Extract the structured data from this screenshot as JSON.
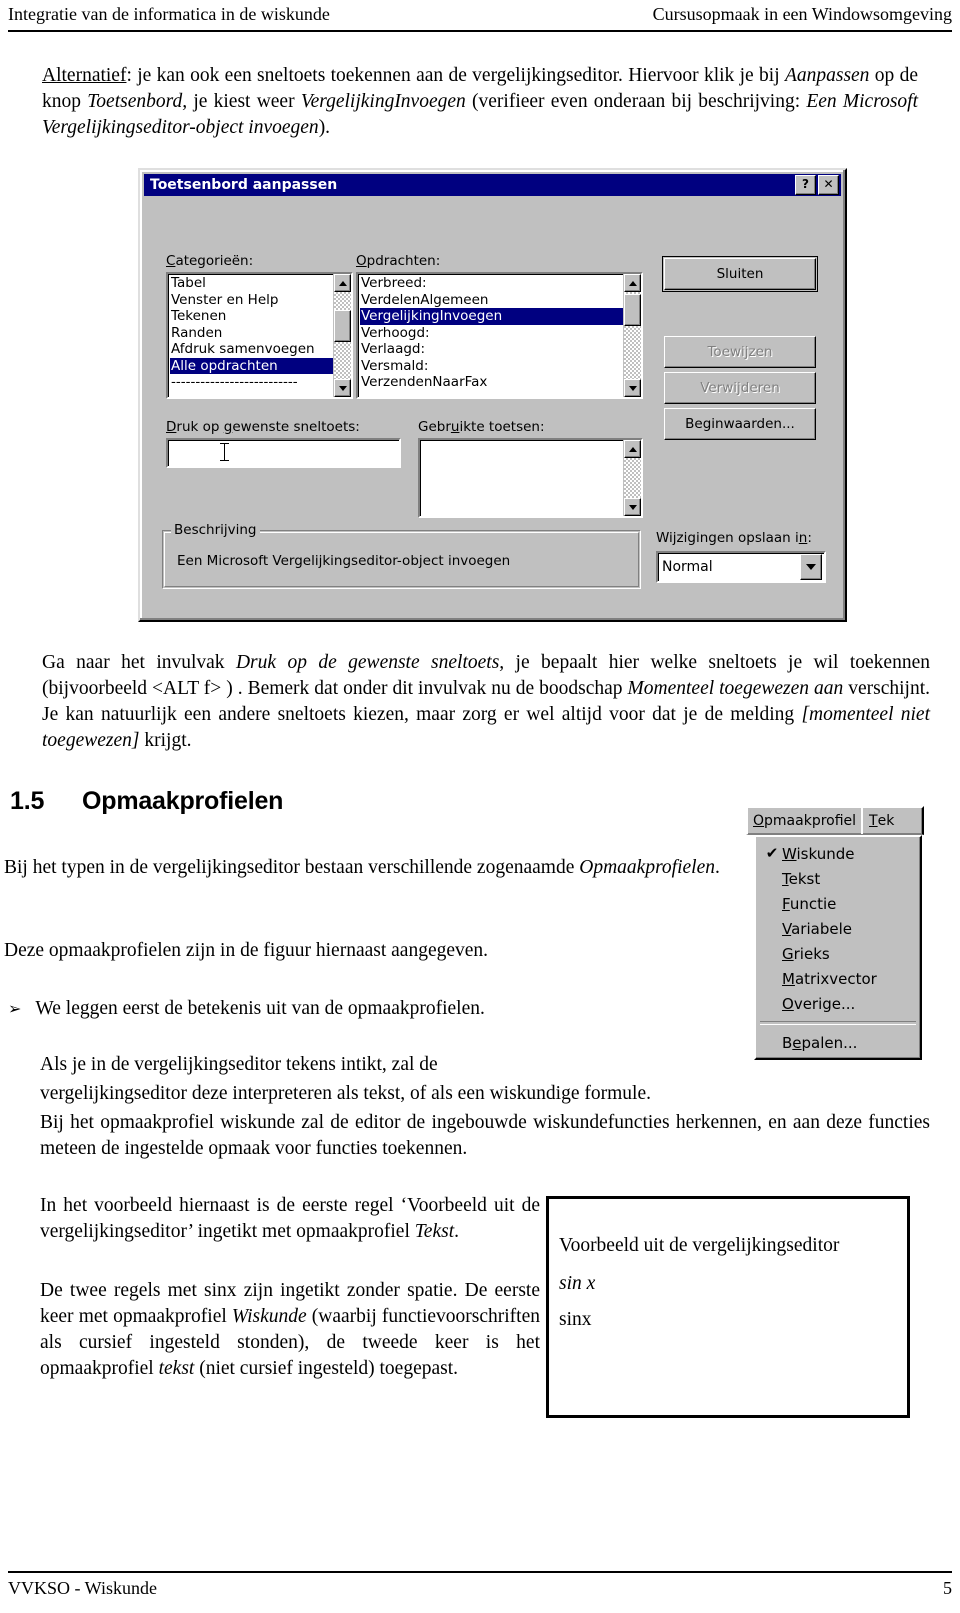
{
  "header": {
    "left": "Integratie van de informatica in de wiskunde",
    "right": "Cursusopmaak in een Windowsomgeving"
  },
  "footer": {
    "left": "VVKSO - Wiskunde",
    "page": "5"
  },
  "intro": {
    "lead": "Alternatief",
    "t1": ": je kan ook een sneltoets toekennen aan de vergelijkingseditor. Hiervoor klik je bij ",
    "i1": "Aanpassen",
    "t2": " op de knop ",
    "i2": "Toetsenbord,",
    "t3": " je kiest weer ",
    "i3": "VergelijkingInvoegen",
    "t4": " (verifieer even onderaan bij beschrijving: ",
    "i4": "Een Microsoft Vergelijkingseditor-object  invoegen",
    "t5": ")."
  },
  "dialog": {
    "title": "Toetsenbord aanpassen",
    "help_button": "?",
    "close_button": "✕",
    "categories_label": "Categorieën:",
    "categories": [
      "Tabel",
      "Venster en Help",
      "Tekenen",
      "Randen",
      "Afdruk samenvoegen",
      "Alle opdrachten",
      "--------------------------"
    ],
    "categories_selected": "Alle opdrachten",
    "commands_label": "Opdrachten:",
    "commands": [
      "Verbreed:",
      "VerdelenAlgemeen",
      "VergelijkingInvoegen",
      "Verhoogd:",
      "Verlaagd:",
      "Versmald:",
      "VerzendenNaarFax"
    ],
    "commands_selected": "VergelijkingInvoegen",
    "shortcut_label": "Druk op gewenste sneltoets:",
    "shortcut_value": "",
    "current_keys_label": "Gebruikte toetsen:",
    "current_keys": [],
    "description_legend": "Beschrijving",
    "description_text": "Een Microsoft Vergelijkingseditor-object invoegen",
    "save_in_label": "Wijzigingen opslaan in:",
    "save_in_value": "Normal",
    "buttons": {
      "close": "Sluiten",
      "assign": "Toewijzen",
      "remove": "Verwijderen",
      "reset": "Beginwaarden..."
    }
  },
  "para_shortcut": {
    "t1": "Ga naar het invulvak ",
    "i1": "Druk op de gewenste sneltoets,",
    "t2": " je bepaalt hier welke sneltoets je wil toekennen (bijvoorbeeld <ALT f> ) . Bemerk dat onder dit invulvak nu de boodschap ",
    "i2": "Momenteel toegewezen aan",
    "t3": "  verschijnt. Je kan natuurlijk een andere sneltoets kiezen, maar zorg er wel altijd voor dat je de melding ",
    "i3": "[momenteel niet toegewezen]",
    "t4": " krijgt."
  },
  "section": {
    "number": "1.5",
    "title": "Opmaakprofielen"
  },
  "para_styles": {
    "t1": "Bij het typen in de vergelijkingseditor bestaan verschillende zogenaamde ",
    "i1": "Opmaakprofielen",
    "t2": "."
  },
  "para_figure": "Deze opmaakprofielen zijn in de figuur hiernaast aangegeven.",
  "bullet": {
    "glyph": "➢",
    "text": "We leggen eerst de betekenis uit van de opmaakprofielen."
  },
  "para_intikt": {
    "line1": "Als je in de vergelijkingseditor tekens intikt, zal de",
    "line2": "vergelijkingseditor deze interpreteren als tekst, of als een wiskundige formule.",
    "line3": "Bij het opmaakprofiel wiskunde zal de editor de ingebouwde wiskundefuncties herkennen, en aan deze functies meteen de ingestelde opmaak voor functies toekennen."
  },
  "stylemenu": {
    "menubar": [
      {
        "label": "Opmaakprofiel",
        "mnemonic": "O"
      },
      {
        "label": "Tek",
        "mnemonic": "T"
      }
    ],
    "items": [
      {
        "label": "Wiskunde",
        "mnemonic": "W",
        "checked": true
      },
      {
        "label": "Tekst",
        "mnemonic": "T",
        "checked": false
      },
      {
        "label": "Functie",
        "mnemonic": "F",
        "checked": false
      },
      {
        "label": "Variabele",
        "mnemonic": "V",
        "checked": false
      },
      {
        "label": "Grieks",
        "mnemonic": "G",
        "checked": false
      },
      {
        "label": "Matrixvector",
        "mnemonic": "M",
        "checked": false
      },
      {
        "label": "Overige...",
        "mnemonic": "O",
        "checked": false
      }
    ],
    "footer_item": {
      "label": "Bepalen...",
      "mnemonic": "e"
    },
    "check_glyph": "✔"
  },
  "para_example": {
    "t1": "In het voorbeeld hiernaast is de eerste regel ‘Voorbeeld uit de vergelijkingseditor’ ingetikt met opmaakprofiel ",
    "i1": "Tekst",
    "t2": ".",
    "t3": "De  twee regels met sinx zijn ingetikt zonder spatie. De eerste keer met opmaakprofiel ",
    "i2": "Wiskunde",
    "t4": " (waarbij functievoorschriften als cursief ingesteld stonden), de tweede keer is het opmaakprofiel ",
    "i3": "tekst",
    "t5": " (niet cursief ingesteld) toegepast."
  },
  "example_box": {
    "line1": "Voorbeeld uit de vergelijkingseditor",
    "line2": "sin x",
    "line3": "sinx"
  }
}
